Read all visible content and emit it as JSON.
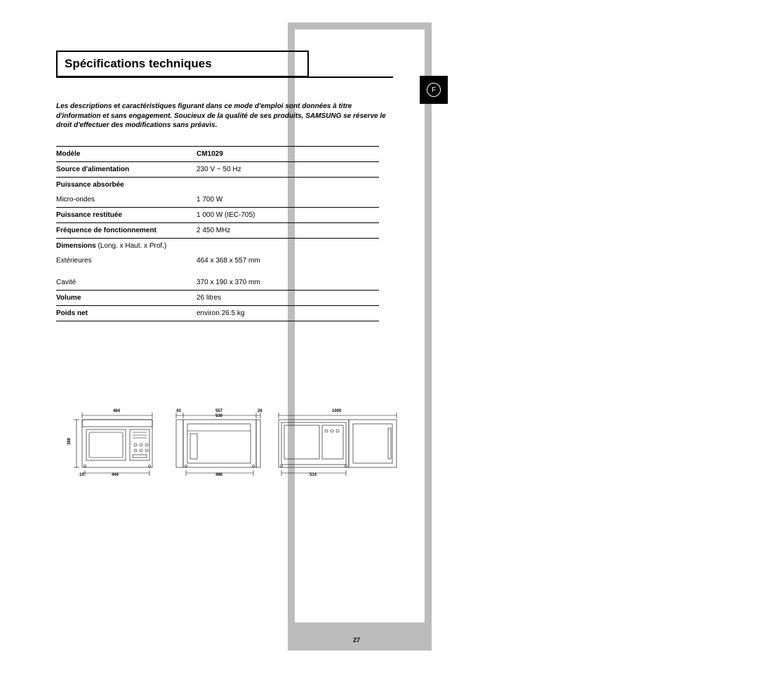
{
  "title": "Spécifications techniques",
  "lang": "F",
  "disclaimer": "Les descriptions et caractéristiques figurant dans ce mode d'emploi sont données à titre d'information et sans engagement. Soucieux de la qualité de ses produits, SAMSUNG se réserve le droit d'effectuer des modifications sans préavis.",
  "table": {
    "model_label": "Modèle",
    "model_value": "CM1029",
    "power_source_label": "Source d'alimentation",
    "power_source_value": "230 V ~ 50 Hz",
    "power_consumption_label": "Puissance absorbée",
    "microwave_label": "Micro-ondes",
    "microwave_value": "1 700 W",
    "output_label": "Puissance restituée",
    "output_value": "1 000 W (IEC-705)",
    "freq_label": "Fréquence de fonctionnement",
    "freq_value": "2 450 MHz",
    "dim_label": "Dimensions",
    "dim_paren": " (Long. x Haut. x Prof.)",
    "ext_label": "Extérieures",
    "ext_value": "464 x 368 x 557 mm",
    "cavity_label": "Cavité",
    "cavity_value": "370 x 190 x 370 mm",
    "volume_label": "Volume",
    "volume_value": "26 litres",
    "weight_label": "Poids net",
    "weight_value": "environ 26.5 kg"
  },
  "diagram": {
    "front": {
      "width_top": "464",
      "height_side": "368",
      "inset_left": "10",
      "bottom": "444"
    },
    "side": {
      "top1": "43",
      "top2": "557",
      "top3": "530",
      "top4": "26",
      "bottom": "486"
    },
    "door": {
      "top": "1000",
      "bottom": "514"
    }
  },
  "page_number": "27"
}
